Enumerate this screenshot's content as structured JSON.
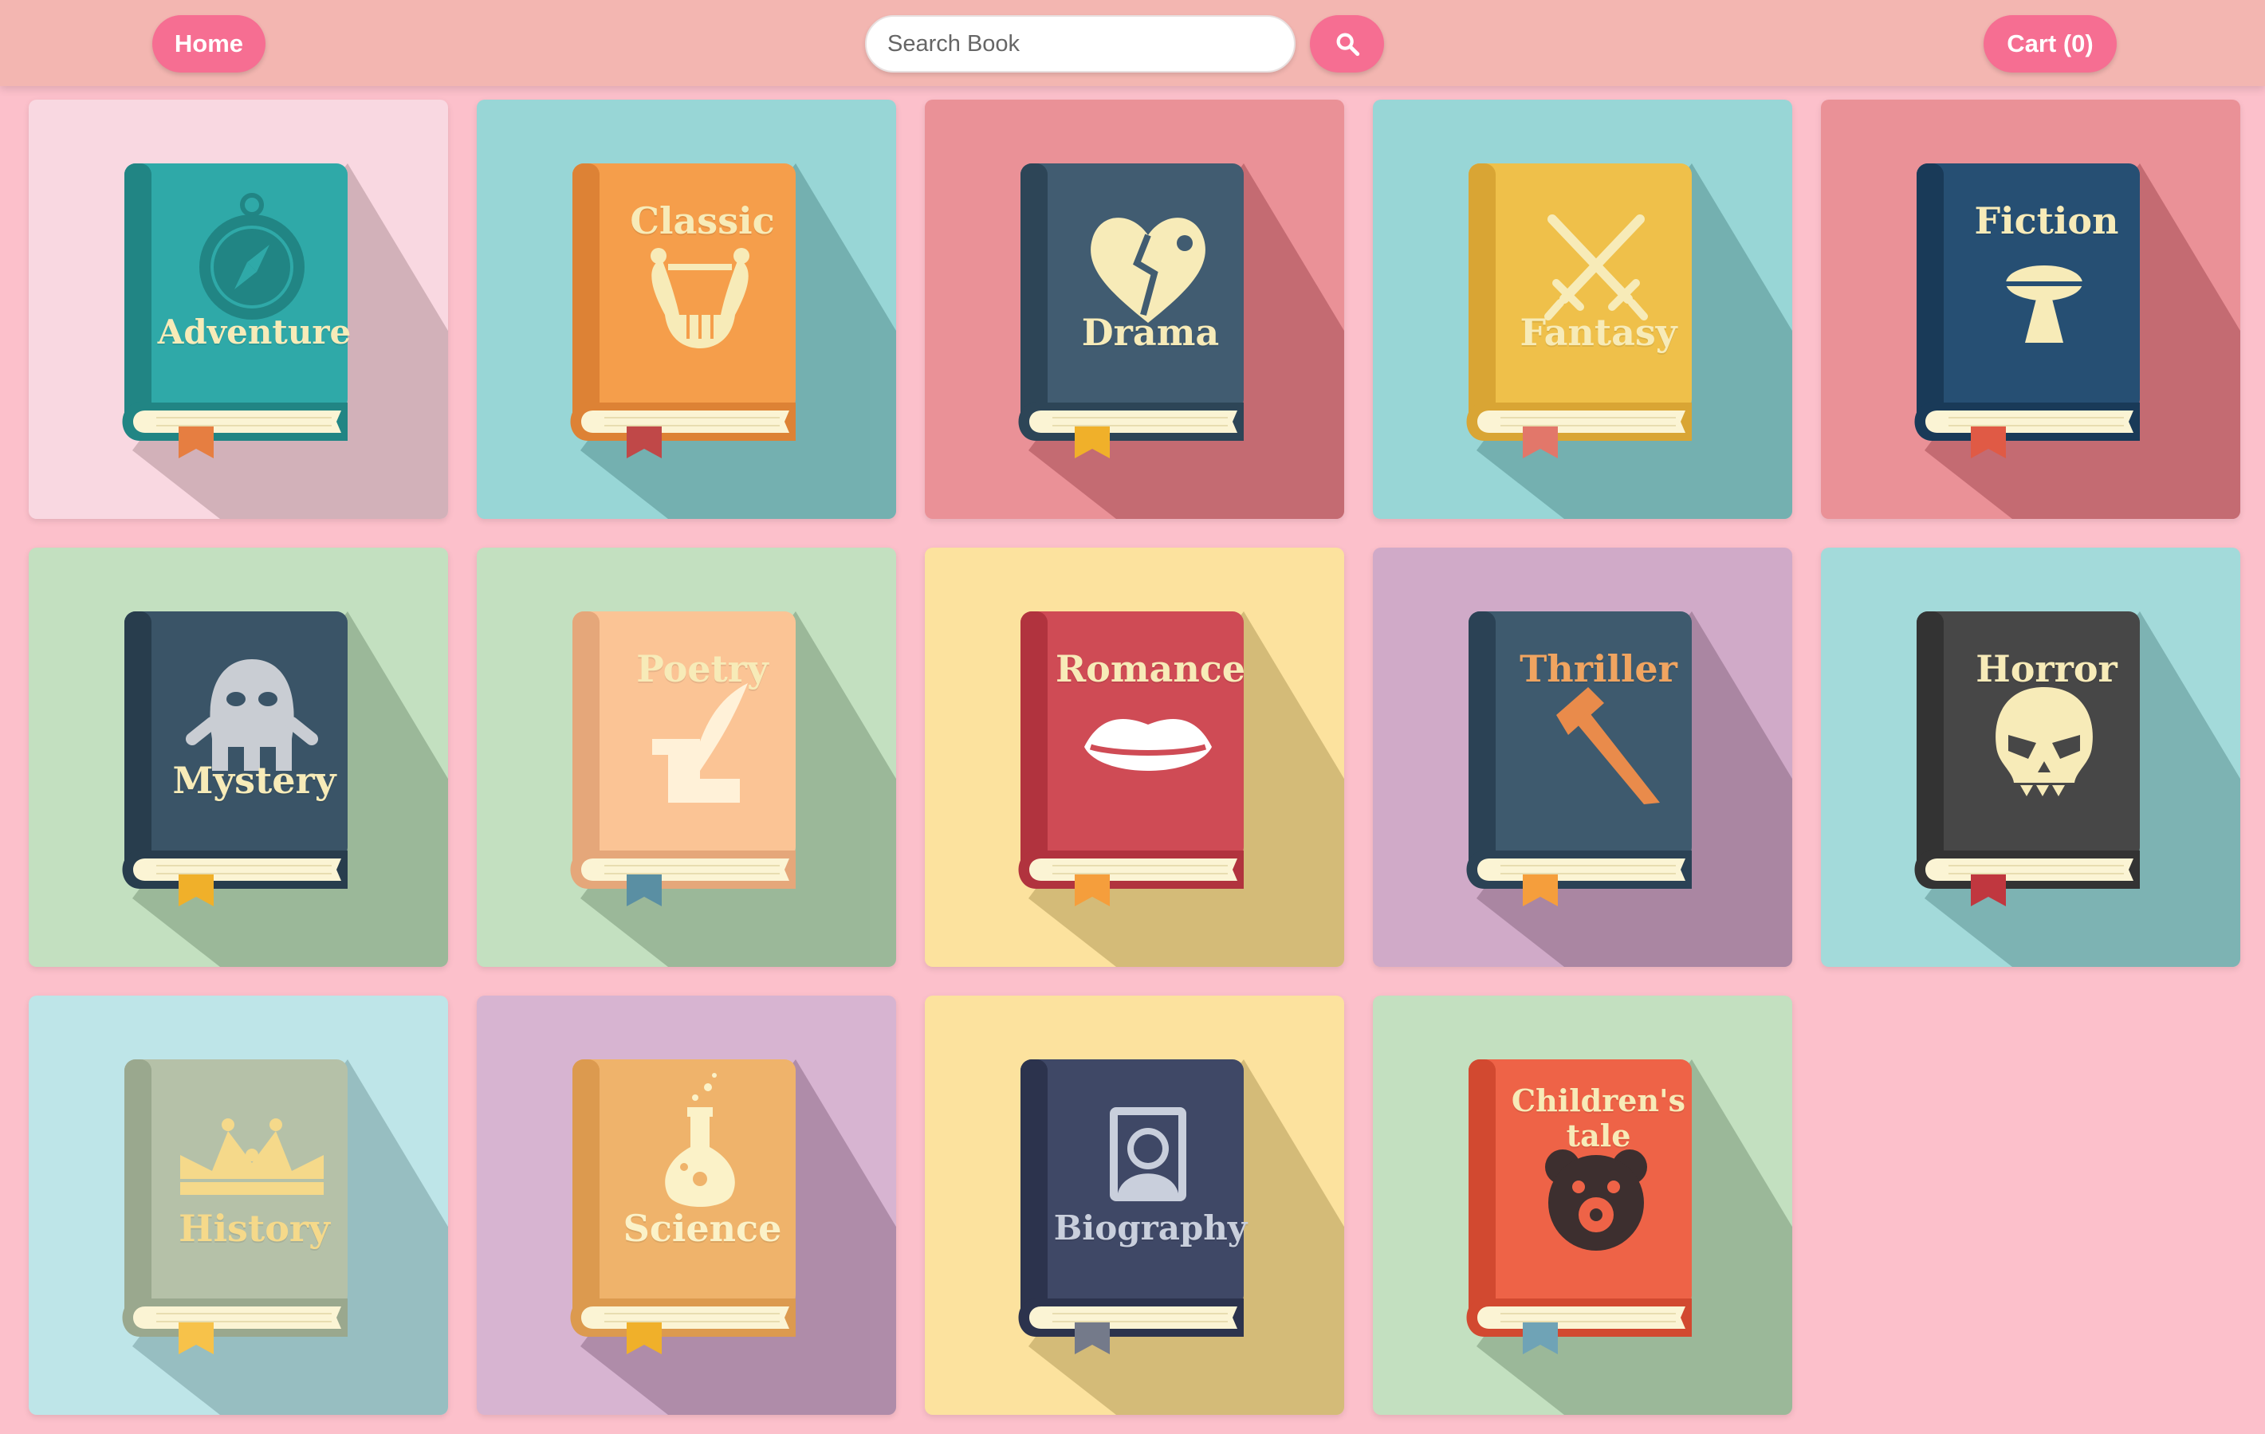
{
  "header": {
    "home_label": "Home",
    "search_placeholder": "Search Book",
    "search_icon": "search-icon",
    "cart_label": "Cart (0)"
  },
  "categories": [
    {
      "title": "Adventure",
      "icon": "compass-icon",
      "bg": "#f9d8e1",
      "shadow": "#d2b1b9",
      "cover": "#2fa9a8",
      "spine": "#218584",
      "text": "#f7ebb8",
      "ribbon": "#e67e41"
    },
    {
      "title": "Classic",
      "icon": "lyre-icon",
      "bg": "#98d6d6",
      "shadow": "#74b0b0",
      "cover": "#f59e4b",
      "spine": "#dd8235",
      "text": "#f7ebb8",
      "ribbon": "#c04848"
    },
    {
      "title": "Drama",
      "icon": "broken-heart-icon",
      "bg": "#ea9197",
      "shadow": "#c46b72",
      "cover": "#415c71",
      "spine": "#2d4557",
      "text": "#f7ebb8",
      "ribbon": "#f0b02a"
    },
    {
      "title": "Fantasy",
      "icon": "crossed-swords-icon",
      "bg": "#98d6d6",
      "shadow": "#74b0b0",
      "cover": "#efc04a",
      "spine": "#d9a534",
      "text": "#f7ebb8",
      "ribbon": "#e2776a"
    },
    {
      "title": "Fiction",
      "icon": "ufo-icon",
      "bg": "#ea9197",
      "shadow": "#c46b72",
      "cover": "#264f73",
      "spine": "#193a58",
      "text": "#f7ebb8",
      "ribbon": "#e05a45"
    },
    {
      "title": "Mystery",
      "icon": "ghost-icon",
      "bg": "#c3e0c0",
      "shadow": "#9bb899",
      "cover": "#3a5467",
      "spine": "#283d4d",
      "text": "#f7ebb8",
      "ribbon": "#f0b02a"
    },
    {
      "title": "Poetry",
      "icon": "quill-scroll-icon",
      "bg": "#c3e0c0",
      "shadow": "#9bb899",
      "cover": "#fbc495",
      "spine": "#e5a77a",
      "text": "#f7ebb8",
      "ribbon": "#5a8fa3"
    },
    {
      "title": "Romance",
      "icon": "lips-icon",
      "bg": "#fce29e",
      "shadow": "#d4bb78",
      "cover": "#cf4b55",
      "spine": "#b1333e",
      "text": "#f7ebb8",
      "ribbon": "#f59e3c"
    },
    {
      "title": "Thriller",
      "icon": "knife-icon",
      "bg": "#d0aac8",
      "shadow": "#aa86a2",
      "cover": "#3e5a6e",
      "spine": "#2b4255",
      "text": "#f0a460",
      "ribbon": "#f59e3c"
    },
    {
      "title": "Horror",
      "icon": "skull-icon",
      "bg": "#a3dada",
      "shadow": "#7db3b3",
      "cover": "#474747",
      "spine": "#333333",
      "text": "#f7ebb8",
      "ribbon": "#c0373f"
    },
    {
      "title": "History",
      "icon": "crown-icon",
      "bg": "#bee5e8",
      "shadow": "#97bec1",
      "cover": "#b5c1a8",
      "spine": "#9aa88e",
      "text": "#f5d98a",
      "ribbon": "#f7c24a"
    },
    {
      "title": "Science",
      "icon": "flask-icon",
      "bg": "#d7b4d1",
      "shadow": "#af8ca9",
      "cover": "#efb36b",
      "spine": "#dc9a4f",
      "text": "#fbf2c8",
      "ribbon": "#f0b02a"
    },
    {
      "title": "Biography",
      "icon": "portrait-icon",
      "bg": "#fce29e",
      "shadow": "#d4bb78",
      "cover": "#3f4866",
      "spine": "#2c334d",
      "text": "#c9cfdc",
      "ribbon": "#747a8a"
    },
    {
      "title": "Children's\ntale",
      "icon": "teddy-bear-icon",
      "bg": "#c3e0c0",
      "shadow": "#9bb899",
      "cover": "#ee6347",
      "spine": "#d24930",
      "text": "#f7ebb8",
      "ribbon": "#6fa3b6"
    }
  ]
}
